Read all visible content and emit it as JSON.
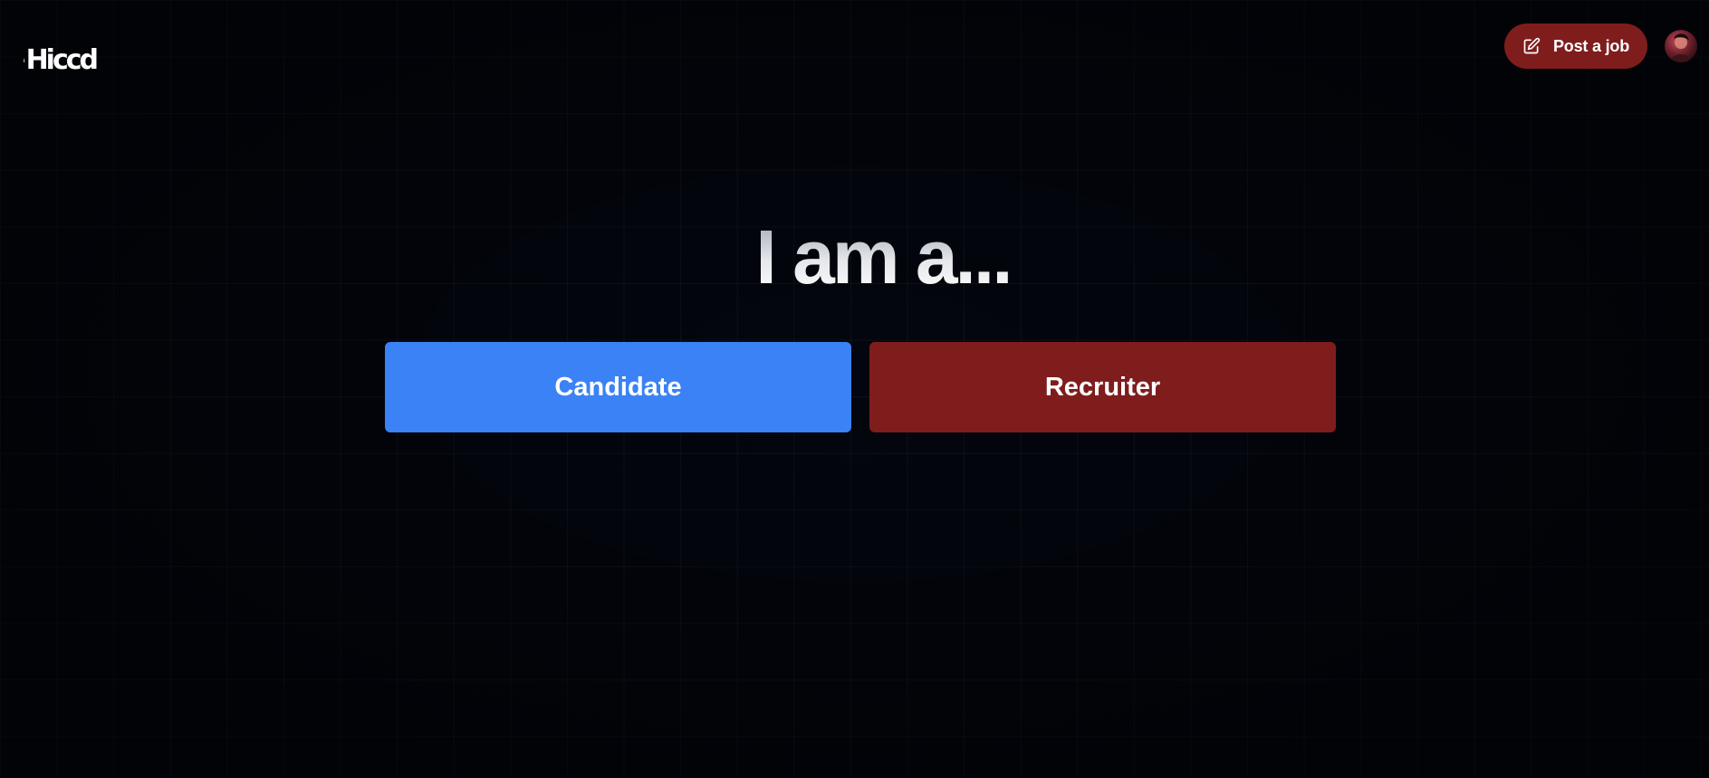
{
  "header": {
    "logo_text": "Hiccd",
    "logo_icon": "person-briefcase-icon",
    "post_job": {
      "label": "Post a job",
      "icon": "edit-square-icon"
    },
    "avatar": "user-avatar"
  },
  "main": {
    "heading": "I am a...",
    "choices": [
      {
        "label": "Candidate",
        "color": "#3b82f6"
      },
      {
        "label": "Recruiter",
        "color": "#7f1d1d"
      }
    ]
  },
  "colors": {
    "background": "#03060e",
    "accent_red": "#7f1d1d",
    "accent_blue": "#3b82f6"
  }
}
